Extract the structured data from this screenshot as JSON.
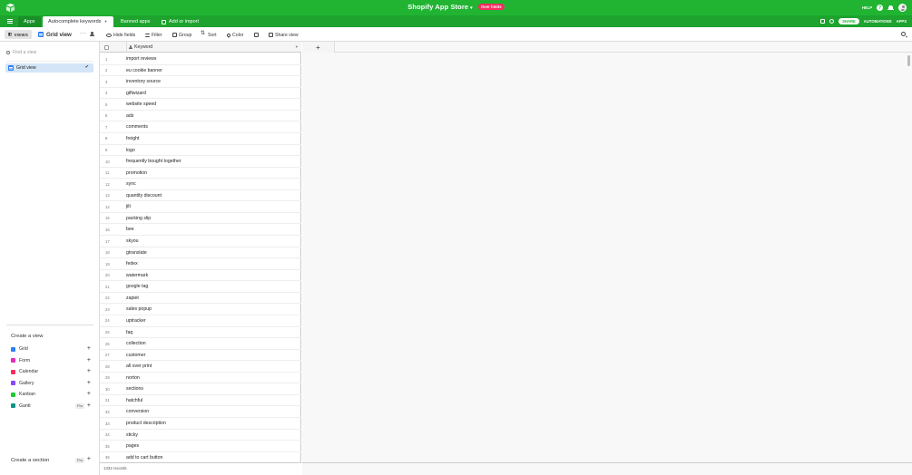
{
  "topbar": {
    "base_title": "Shopify App Store",
    "over_limits_badge": "Over limits",
    "help_label": "HELP",
    "help_question": "?"
  },
  "tabbar": {
    "tabs": [
      {
        "label": "Apps"
      },
      {
        "label": "Autocomplete keywords"
      },
      {
        "label": "Banned apps"
      }
    ],
    "add_import_label": "Add or import",
    "share_label": "SHARE",
    "automations_label": "AUTOMATIONS",
    "apps_label": "APPS"
  },
  "viewbar": {
    "views_label": "VIEWS",
    "current_view": "Grid view",
    "hide_fields": "Hide fields",
    "filter": "Filter",
    "group": "Group",
    "sort": "Sort",
    "color": "Color",
    "share_view": "Share view"
  },
  "sidebar": {
    "find_placeholder": "Find a view",
    "views": [
      {
        "label": "Grid view"
      }
    ],
    "create_view_title": "Create a view",
    "create_items": [
      {
        "label": "Grid",
        "color": "#2d7ff9"
      },
      {
        "label": "Form",
        "color": "#e929ba"
      },
      {
        "label": "Calendar",
        "color": "#f82b60"
      },
      {
        "label": "Gallery",
        "color": "#8b46ff"
      },
      {
        "label": "Kanban",
        "color": "#20c933"
      },
      {
        "label": "Gantt",
        "color": "#0d9488",
        "pro": "Pro"
      }
    ],
    "create_section_title": "Create a section",
    "create_section_pro": "Pro"
  },
  "grid": {
    "column_header": "Keyword",
    "rows": [
      "import reviews",
      "eu cookie banner",
      "inventory source",
      "giftwizard",
      "website speed",
      "ads",
      "comments",
      "freight",
      "logo",
      "frequently bought together",
      "promotion",
      "sync",
      "quantity discount",
      "jilt",
      "packing slip",
      "bee",
      "skyou",
      "gtranslate",
      "fedex",
      "watermark",
      "google tag",
      "zapiet",
      "sales popup",
      "uptracker",
      "faq",
      "collection",
      "customer",
      "all over print",
      "norton",
      "sections",
      "hatchful",
      "conversion",
      "product description",
      "sticky",
      "pages",
      "add to cart button"
    ],
    "record_count": "1332 records",
    "add_column_symbol": "+"
  }
}
